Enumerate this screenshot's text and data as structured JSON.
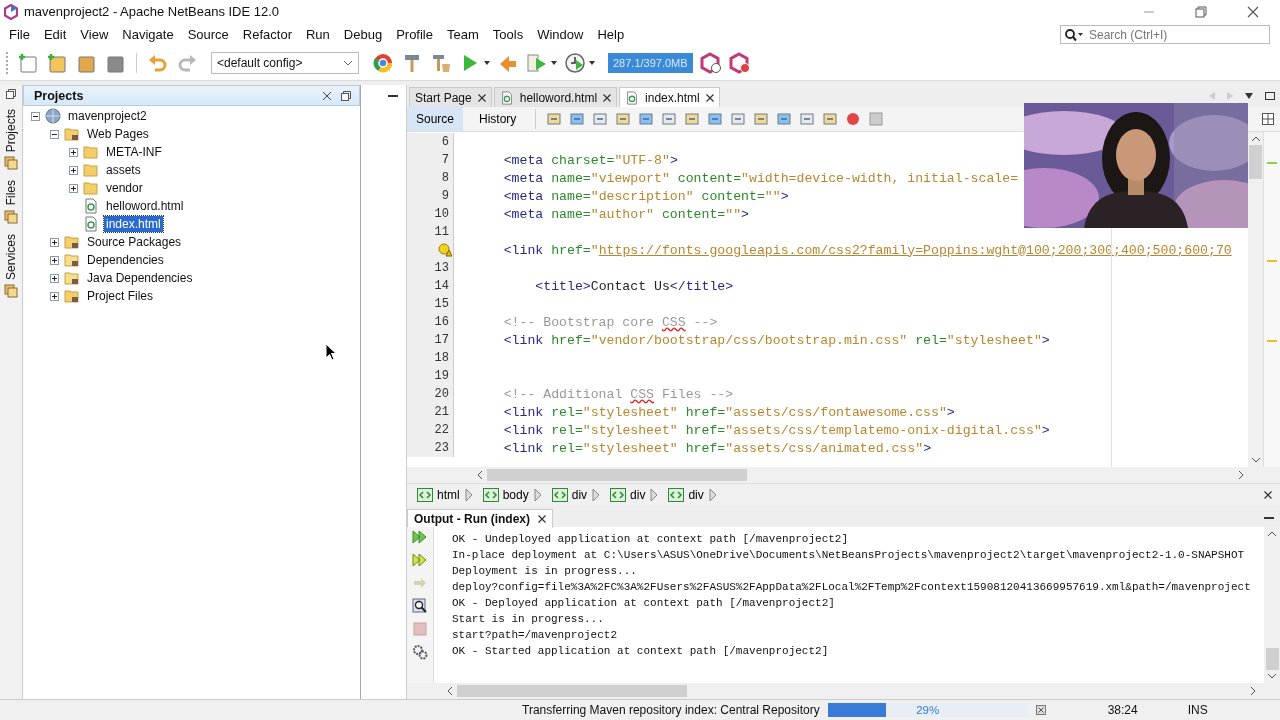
{
  "window": {
    "title": "mavenproject2 - Apache NetBeans IDE 12.0"
  },
  "menu": [
    "File",
    "Edit",
    "View",
    "Navigate",
    "Source",
    "Refactor",
    "Run",
    "Debug",
    "Profile",
    "Team",
    "Tools",
    "Window",
    "Help"
  ],
  "search": {
    "placeholder": "Search (Ctrl+I)"
  },
  "toolbar": {
    "config": "<default config>",
    "memory": "287.1/397.0MB"
  },
  "side_tabs": [
    "Projects",
    "Files",
    "Services"
  ],
  "projects": {
    "title": "Projects",
    "tree": [
      {
        "label": "mavenproject2",
        "kind": "project",
        "expanded": true,
        "selected": false,
        "children": [
          {
            "label": "Web Pages",
            "kind": "web-folder",
            "expanded": true,
            "selected": false,
            "children": [
              {
                "label": "META-INF",
                "kind": "folder",
                "expanded": false,
                "selected": false
              },
              {
                "label": "assets",
                "kind": "folder",
                "expanded": false,
                "selected": false
              },
              {
                "label": "vendor",
                "kind": "folder",
                "expanded": false,
                "selected": false
              },
              {
                "label": "helloword.html",
                "kind": "file",
                "selected": false
              },
              {
                "label": "index.html",
                "kind": "file",
                "selected": true
              }
            ]
          },
          {
            "label": "Source Packages",
            "kind": "package-folder",
            "expanded": false,
            "selected": false
          },
          {
            "label": "Dependencies",
            "kind": "library",
            "expanded": false,
            "selected": false
          },
          {
            "label": "Java Dependencies",
            "kind": "library",
            "expanded": false,
            "selected": false
          },
          {
            "label": "Project Files",
            "kind": "config-folder",
            "expanded": false,
            "selected": false
          }
        ]
      }
    ]
  },
  "editor": {
    "tabs": [
      {
        "label": "Start Page",
        "kind": "page",
        "selected": false
      },
      {
        "label": "helloword.html",
        "kind": "file",
        "selected": false
      },
      {
        "label": "index.html",
        "kind": "file",
        "selected": true
      }
    ],
    "views": [
      {
        "label": "Source",
        "selected": true
      },
      {
        "label": "History",
        "selected": false
      }
    ],
    "lines": [
      {
        "number": "6",
        "hint": false
      },
      {
        "number": "7",
        "hint": false,
        "tokens": [
          {
            "kind": "tag",
            "text": "    <meta"
          },
          {
            "kind": "attr",
            "text": " charset="
          },
          {
            "kind": "value",
            "text": "\"UTF-8\""
          },
          {
            "kind": "tag",
            "text": ">"
          }
        ]
      },
      {
        "number": "8",
        "hint": false,
        "tokens": [
          {
            "kind": "tag",
            "text": "    <meta"
          },
          {
            "kind": "attr",
            "text": " name="
          },
          {
            "kind": "value",
            "text": "\"viewport\""
          },
          {
            "kind": "attr",
            "text": " content="
          },
          {
            "kind": "value",
            "text": "\"width=device-width, initial-scale="
          }
        ]
      },
      {
        "number": "9",
        "hint": false,
        "tokens": [
          {
            "kind": "tag",
            "text": "    <meta"
          },
          {
            "kind": "attr",
            "text": " name="
          },
          {
            "kind": "value",
            "text": "\"description\""
          },
          {
            "kind": "attr",
            "text": " content="
          },
          {
            "kind": "value",
            "text": "\"\""
          },
          {
            "kind": "tag",
            "text": ">"
          }
        ]
      },
      {
        "number": "10",
        "hint": false,
        "tokens": [
          {
            "kind": "tag",
            "text": "    <meta"
          },
          {
            "kind": "attr",
            "text": " name="
          },
          {
            "kind": "value",
            "text": "\"author\""
          },
          {
            "kind": "attr",
            "text": " content="
          },
          {
            "kind": "value",
            "text": "\"\""
          },
          {
            "kind": "tag",
            "text": ">"
          }
        ]
      },
      {
        "number": "11",
        "hint": false
      },
      {
        "hint": true,
        "tokens": [
          {
            "kind": "tag",
            "text": "    <link"
          },
          {
            "kind": "attr",
            "text": " href="
          },
          {
            "kind": "value",
            "text": "\""
          },
          {
            "kind": "link",
            "text": "https://fonts.googleapis.com/css2?family=Poppins:wght@100;200;300;400;500;600;70"
          }
        ]
      },
      {
        "number": "13",
        "hint": false
      },
      {
        "number": "14",
        "hint": false,
        "tokens": [
          {
            "kind": "tag",
            "text": "        <title>"
          },
          {
            "kind": "plain",
            "text": "Contact Us"
          },
          {
            "kind": "tag",
            "text": "</title>"
          }
        ]
      },
      {
        "number": "15",
        "hint": false
      },
      {
        "number": "16",
        "hint": false,
        "tokens": [
          {
            "kind": "comment",
            "text": "    <!-- Bootstrap core "
          },
          {
            "kind": "misspelled",
            "text": "CSS"
          },
          {
            "kind": "comment",
            "text": " -->"
          }
        ]
      },
      {
        "number": "17",
        "hint": false,
        "tokens": [
          {
            "kind": "tag",
            "text": "    <link"
          },
          {
            "kind": "attr",
            "text": " href="
          },
          {
            "kind": "value",
            "text": "\"vendor/bootstrap/css/bootstrap.min.css\""
          },
          {
            "kind": "attr",
            "text": " rel="
          },
          {
            "kind": "value",
            "text": "\"stylesheet\""
          },
          {
            "kind": "tag",
            "text": ">"
          }
        ]
      },
      {
        "number": "18",
        "hint": false
      },
      {
        "number": "19",
        "hint": false
      },
      {
        "number": "20",
        "hint": false,
        "tokens": [
          {
            "kind": "comment",
            "text": "    <!-- Additional "
          },
          {
            "kind": "misspelled",
            "text": "CSS"
          },
          {
            "kind": "comment",
            "text": " Files -->"
          }
        ]
      },
      {
        "number": "21",
        "hint": false,
        "tokens": [
          {
            "kind": "tag",
            "text": "    <link"
          },
          {
            "kind": "attr",
            "text": " rel="
          },
          {
            "kind": "value",
            "text": "\"stylesheet\""
          },
          {
            "kind": "attr",
            "text": " href="
          },
          {
            "kind": "value",
            "text": "\"assets/css/fontawesome.css\""
          },
          {
            "kind": "tag",
            "text": ">"
          }
        ]
      },
      {
        "number": "22",
        "hint": false,
        "tokens": [
          {
            "kind": "tag",
            "text": "    <link"
          },
          {
            "kind": "attr",
            "text": " rel="
          },
          {
            "kind": "value",
            "text": "\"stylesheet\""
          },
          {
            "kind": "attr",
            "text": " href="
          },
          {
            "kind": "value",
            "text": "\"assets/css/templatemo-onix-digital.css\""
          },
          {
            "kind": "tag",
            "text": ">"
          }
        ]
      },
      {
        "number": "23",
        "hint": false,
        "tokens": [
          {
            "kind": "tag",
            "text": "    <link"
          },
          {
            "kind": "attr",
            "text": " rel="
          },
          {
            "kind": "value",
            "text": "\"stylesheet\""
          },
          {
            "kind": "attr",
            "text": " href="
          },
          {
            "kind": "value",
            "text": "\"assets/css/animated.css\""
          },
          {
            "kind": "tag",
            "text": ">"
          }
        ]
      }
    ],
    "breadcrumbs": [
      "html",
      "body",
      "div",
      "div",
      "div"
    ]
  },
  "output": {
    "title": "Output - Run (index)",
    "lines": [
      "OK - Undeployed application at context path [/mavenproject2]",
      "In-place deployment at C:\\Users\\ASUS\\OneDrive\\Documents\\NetBeansProjects\\mavenproject2\\target\\mavenproject2-1.0-SNAPSHOT",
      "Deployment is in progress...",
      "deploy?config=file%3A%2FC%3A%2FUsers%2FASUS%2FAppData%2FLocal%2FTemp%2Fcontext15908120413669957619.xml&path=/mavenproject",
      "OK - Deployed application at context path [/mavenproject2]",
      "Start is in progress...",
      "start?path=/mavenproject2",
      "OK - Started application at context path [/mavenproject2]"
    ]
  },
  "status_bar": {
    "task": "Transferring Maven repository index: Central Repository",
    "progress": {
      "level": 0.29,
      "label": "29%"
    },
    "position": "38:24",
    "mode": "INS"
  },
  "video": {
    "kind": "picture"
  }
}
